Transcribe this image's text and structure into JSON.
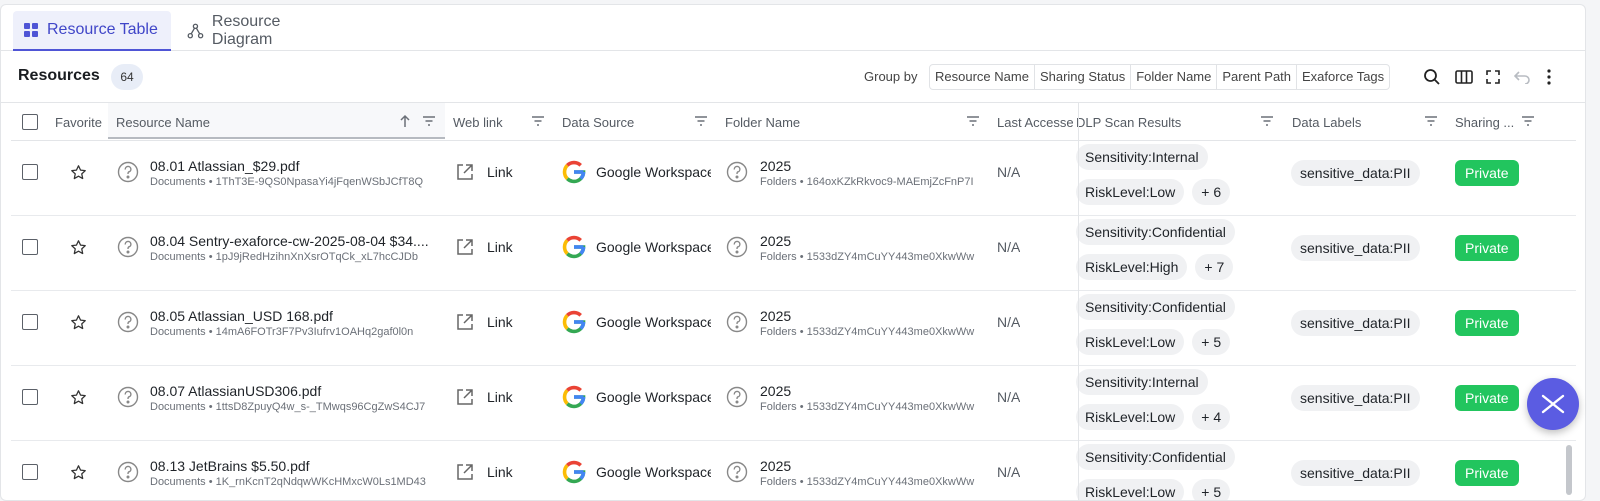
{
  "tabs": [
    {
      "label": "Resource Table",
      "active": true
    },
    {
      "label": "Resource Diagram",
      "active": false
    }
  ],
  "header": {
    "title": "Resources",
    "count": "64",
    "group_by_label": "Group by",
    "group_by": [
      "Resource Name",
      "Sharing Status",
      "Folder Name",
      "Parent Path",
      "Exaforce Tags"
    ]
  },
  "columns": {
    "favorite": "Favorite",
    "resource_name": "Resource Name",
    "web_link": "Web link",
    "data_source": "Data Source",
    "folder_name": "Folder Name",
    "last_access": "Last Accesse",
    "dlp": "DLP Scan Results",
    "data_labels": "Data Labels",
    "sharing": "Sharing ..."
  },
  "rows": [
    {
      "name": "08.01 Atlassian_$29.pdf",
      "type": "Documents",
      "id": "1ThT3E-9QS0NpasaYi4jFqenWSbJCfT8Q",
      "link": "Link",
      "source": "Google Workspace",
      "folder": "2025",
      "folder_type": "Folders",
      "folder_id": "164oxKZkRkvoc9-MAEmjZcFnP7I",
      "last": "N/A",
      "dlp1": "Sensitivity:Internal",
      "dlp2": "RiskLevel:Low",
      "more": "+ 6",
      "label": "sensitive_data:PII",
      "sharing": "Private"
    },
    {
      "name": "08.04 Sentry-exaforce-cw-2025-08-04 $34....",
      "type": "Documents",
      "id": "1pJ9jRedHzihnXnXsrOTqCk_xL7hcCJDb",
      "link": "Link",
      "source": "Google Workspace",
      "folder": "2025",
      "folder_type": "Folders",
      "folder_id": "1533dZY4mCuYY443me0XkwWw",
      "last": "N/A",
      "dlp1": "Sensitivity:Confidential",
      "dlp2": "RiskLevel:High",
      "more": "+ 7",
      "label": "sensitive_data:PII",
      "sharing": "Private"
    },
    {
      "name": "08.05 Atlassian_USD 168.pdf",
      "type": "Documents",
      "id": "14mA6FOTr3F7Pv3Iufrv1OAHq2gaf0l0n",
      "link": "Link",
      "source": "Google Workspace",
      "folder": "2025",
      "folder_type": "Folders",
      "folder_id": "1533dZY4mCuYY443me0XkwWw",
      "last": "N/A",
      "dlp1": "Sensitivity:Confidential",
      "dlp2": "RiskLevel:Low",
      "more": "+ 5",
      "label": "sensitive_data:PII",
      "sharing": "Private"
    },
    {
      "name": "08.07 AtlassianUSD306.pdf",
      "type": "Documents",
      "id": "1ttsD8ZpuyQ4w_s-_TMwqs96CgZwS4CJ7",
      "link": "Link",
      "source": "Google Workspace",
      "folder": "2025",
      "folder_type": "Folders",
      "folder_id": "1533dZY4mCuYY443me0XkwWw",
      "last": "N/A",
      "dlp1": "Sensitivity:Internal",
      "dlp2": "RiskLevel:Low",
      "more": "+ 4",
      "label": "sensitive_data:PII",
      "sharing": "Private"
    },
    {
      "name": "08.13 JetBrains $5.50.pdf",
      "type": "Documents",
      "id": "1K_rnKcnT2qNdqwWKcHMxcW0Ls1MD43",
      "link": "Link",
      "source": "Google Workspace",
      "folder": "2025",
      "folder_type": "Folders",
      "folder_id": "1533dZY4mCuYY443me0XkwWw",
      "last": "N/A",
      "dlp1": "Sensitivity:Confidential",
      "dlp2": "RiskLevel:Low",
      "more": "+ 5",
      "label": "sensitive_data:PII",
      "sharing": "Private"
    }
  ],
  "colors": {
    "accent": "#4f55d6",
    "private": "#22c55e",
    "fab": "#5b5ce2"
  },
  "icons": [
    "grid-icon",
    "diagram-icon",
    "search-icon",
    "columns-icon",
    "fullscreen-icon",
    "undo-icon",
    "more-vertical-icon",
    "star-icon",
    "question-circle-icon",
    "external-link-icon",
    "google-icon",
    "filter-icon",
    "sort-up-icon",
    "exaforce-logo-icon"
  ]
}
